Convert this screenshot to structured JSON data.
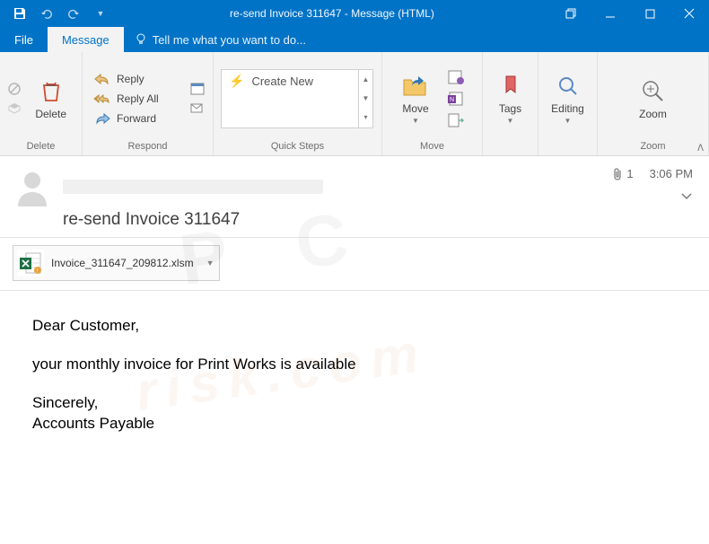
{
  "window": {
    "title": "re-send Invoice 311647 - Message (HTML)"
  },
  "tabs": {
    "file": "File",
    "message": "Message",
    "tellme": "Tell me what you want to do..."
  },
  "ribbon": {
    "delete": {
      "label": "Delete",
      "group": "Delete"
    },
    "respond": {
      "reply": "Reply",
      "replyAll": "Reply All",
      "forward": "Forward",
      "group": "Respond"
    },
    "quicksteps": {
      "createNew": "Create New",
      "group": "Quick Steps"
    },
    "move": {
      "label": "Move",
      "group": "Move"
    },
    "tags": {
      "label": "Tags",
      "group": ""
    },
    "editing": {
      "label": "Editing",
      "group": ""
    },
    "zoom": {
      "label": "Zoom",
      "group": "Zoom"
    }
  },
  "message": {
    "subject": "re-send Invoice 311647",
    "time": "3:06 PM",
    "attachCount": "1",
    "attachment": "Invoice_311647_209812.xlsm",
    "body": {
      "greeting": "Dear Customer,",
      "line1": "your monthly invoice for Print Works is available",
      "closing": "Sincerely,",
      "signature": "Accounts Payable"
    }
  }
}
